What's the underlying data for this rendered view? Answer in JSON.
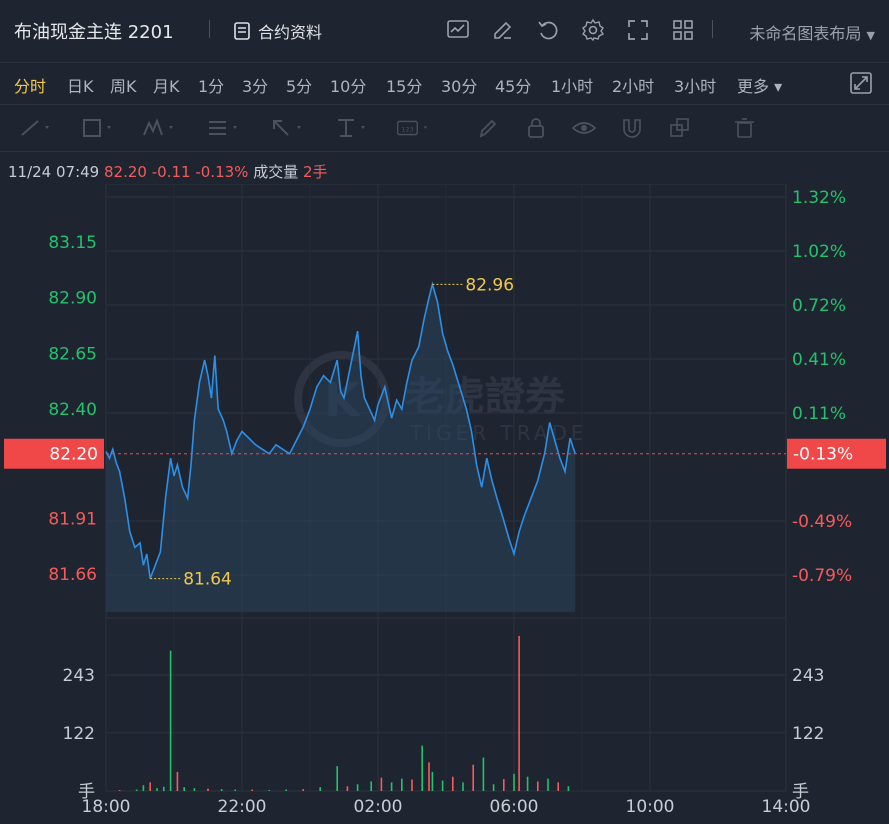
{
  "header": {
    "title": "布油现金主连 2201",
    "info_label": "合约资料",
    "layout_label": "未命名图表布局"
  },
  "periods": [
    {
      "label": "分时",
      "active": true
    },
    {
      "label": "日K"
    },
    {
      "label": "周K"
    },
    {
      "label": "月K"
    },
    {
      "label": "1分"
    },
    {
      "label": "3分"
    },
    {
      "label": "5分"
    },
    {
      "label": "10分"
    },
    {
      "label": "15分"
    },
    {
      "label": "30分"
    },
    {
      "label": "45分"
    },
    {
      "label": "1小时"
    },
    {
      "label": "2小时"
    },
    {
      "label": "3小时"
    },
    {
      "label": "更多"
    }
  ],
  "quote": {
    "datetime": "11/24 07:49",
    "price": "82.20",
    "change": "-0.11",
    "change_pct": "-0.13%",
    "volume_label": "成交量",
    "volume": "2手"
  },
  "watermark": {
    "cn": "老虎證券",
    "en": "TIGER TRADE"
  },
  "colors": {
    "up": "#23c26b",
    "down": "#f45b5b",
    "line": "#2d8fe6",
    "accent": "#f2c94c",
    "tag": "#f04848"
  },
  "chart_data": {
    "type": "line",
    "x_ticks": [
      "18:00",
      "22:00",
      "02:00",
      "06:00",
      "10:00",
      "14:00"
    ],
    "price_ticks": [
      83.15,
      82.9,
      82.65,
      82.4,
      81.91,
      81.66
    ],
    "pct_ticks": [
      "1.32%",
      "1.02%",
      "0.72%",
      "0.41%",
      "0.11%",
      "-0.49%",
      "-0.79%"
    ],
    "ylim": [
      81.49,
      83.41
    ],
    "prev_close": 82.31,
    "current": {
      "price": "82.20",
      "pct": "-0.13%"
    },
    "high": {
      "label": "82.96",
      "value": 82.96,
      "time_h": 9.6
    },
    "low": {
      "label": "81.64",
      "value": 81.64,
      "time_h": 1.3
    },
    "price_series": [
      [
        0,
        82.21
      ],
      [
        0.1,
        82.18
      ],
      [
        0.2,
        82.22
      ],
      [
        0.3,
        82.16
      ],
      [
        0.4,
        82.12
      ],
      [
        0.55,
        82.0
      ],
      [
        0.7,
        81.85
      ],
      [
        0.85,
        81.78
      ],
      [
        1.0,
        81.8
      ],
      [
        1.1,
        81.7
      ],
      [
        1.2,
        81.75
      ],
      [
        1.3,
        81.64
      ],
      [
        1.45,
        81.7
      ],
      [
        1.6,
        81.76
      ],
      [
        1.75,
        82.0
      ],
      [
        1.9,
        82.18
      ],
      [
        2.0,
        82.1
      ],
      [
        2.1,
        82.15
      ],
      [
        2.25,
        82.05
      ],
      [
        2.4,
        82.0
      ],
      [
        2.5,
        82.15
      ],
      [
        2.6,
        82.35
      ],
      [
        2.75,
        82.52
      ],
      [
        2.9,
        82.62
      ],
      [
        3.0,
        82.55
      ],
      [
        3.1,
        82.45
      ],
      [
        3.2,
        82.64
      ],
      [
        3.3,
        82.4
      ],
      [
        3.45,
        82.35
      ],
      [
        3.55,
        82.3
      ],
      [
        3.7,
        82.2
      ],
      [
        3.85,
        82.26
      ],
      [
        4.0,
        82.3
      ],
      [
        4.2,
        82.27
      ],
      [
        4.4,
        82.24
      ],
      [
        4.6,
        82.22
      ],
      [
        4.8,
        82.2
      ],
      [
        5.0,
        82.24
      ],
      [
        5.2,
        82.22
      ],
      [
        5.4,
        82.2
      ],
      [
        5.6,
        82.26
      ],
      [
        5.8,
        82.32
      ],
      [
        6.0,
        82.4
      ],
      [
        6.2,
        82.5
      ],
      [
        6.4,
        82.55
      ],
      [
        6.6,
        82.52
      ],
      [
        6.8,
        82.62
      ],
      [
        6.9,
        82.48
      ],
      [
        7.0,
        82.45
      ],
      [
        7.2,
        82.6
      ],
      [
        7.4,
        82.75
      ],
      [
        7.5,
        82.55
      ],
      [
        7.6,
        82.45
      ],
      [
        7.75,
        82.4
      ],
      [
        7.9,
        82.35
      ],
      [
        8.0,
        82.42
      ],
      [
        8.2,
        82.5
      ],
      [
        8.4,
        82.36
      ],
      [
        8.55,
        82.44
      ],
      [
        8.7,
        82.4
      ],
      [
        8.85,
        82.52
      ],
      [
        9.0,
        82.62
      ],
      [
        9.2,
        82.68
      ],
      [
        9.35,
        82.8
      ],
      [
        9.5,
        82.9
      ],
      [
        9.6,
        82.96
      ],
      [
        9.75,
        82.88
      ],
      [
        9.9,
        82.74
      ],
      [
        10.05,
        82.66
      ],
      [
        10.2,
        82.6
      ],
      [
        10.4,
        82.5
      ],
      [
        10.6,
        82.4
      ],
      [
        10.75,
        82.3
      ],
      [
        10.9,
        82.15
      ],
      [
        11.05,
        82.05
      ],
      [
        11.2,
        82.18
      ],
      [
        11.35,
        82.08
      ],
      [
        11.5,
        82.0
      ],
      [
        11.7,
        81.9
      ],
      [
        11.85,
        81.82
      ],
      [
        12.0,
        81.75
      ],
      [
        12.15,
        81.85
      ],
      [
        12.3,
        81.92
      ],
      [
        12.5,
        82.0
      ],
      [
        12.7,
        82.08
      ],
      [
        12.9,
        82.2
      ],
      [
        13.05,
        82.34
      ],
      [
        13.2,
        82.26
      ],
      [
        13.35,
        82.18
      ],
      [
        13.5,
        82.12
      ],
      [
        13.65,
        82.27
      ],
      [
        13.8,
        82.2
      ]
    ],
    "volume_ticks": [
      "243",
      "122",
      "手"
    ],
    "volume_bars": [
      [
        0.4,
        2,
        "down"
      ],
      [
        0.9,
        3,
        "up"
      ],
      [
        1.1,
        12,
        "up"
      ],
      [
        1.3,
        18,
        "down"
      ],
      [
        1.5,
        6,
        "up"
      ],
      [
        1.7,
        9,
        "up"
      ],
      [
        1.9,
        294,
        "up"
      ],
      [
        2.1,
        40,
        "down"
      ],
      [
        2.3,
        8,
        "up"
      ],
      [
        2.6,
        6,
        "up"
      ],
      [
        3.0,
        5,
        "down"
      ],
      [
        3.4,
        4,
        "up"
      ],
      [
        3.8,
        3,
        "up"
      ],
      [
        4.3,
        3,
        "down"
      ],
      [
        4.8,
        2,
        "up"
      ],
      [
        5.3,
        3,
        "up"
      ],
      [
        5.8,
        4,
        "down"
      ],
      [
        6.3,
        8,
        "up"
      ],
      [
        6.8,
        52,
        "up"
      ],
      [
        7.1,
        10,
        "down"
      ],
      [
        7.4,
        14,
        "up"
      ],
      [
        7.8,
        20,
        "up"
      ],
      [
        8.1,
        28,
        "down"
      ],
      [
        8.4,
        18,
        "up"
      ],
      [
        8.7,
        26,
        "up"
      ],
      [
        9.0,
        24,
        "down"
      ],
      [
        9.3,
        95,
        "up"
      ],
      [
        9.5,
        60,
        "down"
      ],
      [
        9.6,
        40,
        "up"
      ],
      [
        9.9,
        22,
        "up"
      ],
      [
        10.2,
        30,
        "down"
      ],
      [
        10.5,
        18,
        "up"
      ],
      [
        10.8,
        55,
        "down"
      ],
      [
        11.1,
        70,
        "up"
      ],
      [
        11.4,
        14,
        "up"
      ],
      [
        11.7,
        25,
        "down"
      ],
      [
        12.0,
        36,
        "up"
      ],
      [
        12.15,
        325,
        "down"
      ],
      [
        12.4,
        30,
        "up"
      ],
      [
        12.7,
        20,
        "down"
      ],
      [
        13.0,
        26,
        "up"
      ],
      [
        13.3,
        18,
        "down"
      ],
      [
        13.6,
        10,
        "up"
      ]
    ],
    "volume_max": 350,
    "hours_span": 20
  }
}
